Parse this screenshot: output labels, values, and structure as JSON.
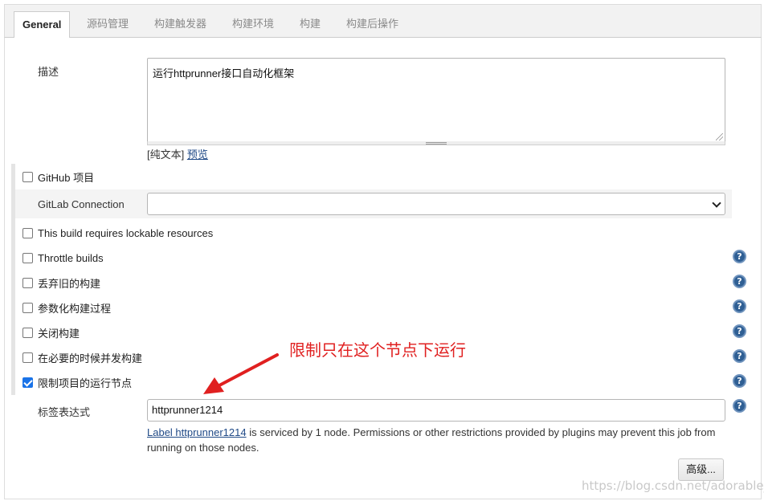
{
  "tabs": [
    {
      "label": "General",
      "active": true
    },
    {
      "label": "源码管理",
      "active": false
    },
    {
      "label": "构建触发器",
      "active": false
    },
    {
      "label": "构建环境",
      "active": false
    },
    {
      "label": "构建",
      "active": false
    },
    {
      "label": "构建后操作",
      "active": false
    }
  ],
  "description": {
    "label": "描述",
    "value": "运行httprunner接口自动化框架",
    "plain_text": "[纯文本]",
    "preview_link": "预览"
  },
  "options": {
    "github_project": {
      "label": "GitHub 项目",
      "checked": false
    },
    "gitlab_connection": {
      "label": "GitLab Connection",
      "value": ""
    },
    "lockable_resources": {
      "label": "This build requires lockable resources",
      "checked": false
    },
    "throttle_builds": {
      "label": "Throttle builds",
      "checked": false
    },
    "discard_old": {
      "label": "丢弃旧的构建",
      "checked": false
    },
    "parameterized": {
      "label": "参数化构建过程",
      "checked": false
    },
    "disable_build": {
      "label": "关闭构建",
      "checked": false
    },
    "concurrent": {
      "label": "在必要的时候并发构建",
      "checked": false
    },
    "restrict_node": {
      "label": "限制项目的运行节点",
      "checked": true
    }
  },
  "label_expression": {
    "label": "标签表达式",
    "value": "httprunner1214",
    "info_link": "Label httprunner1214",
    "info_text": " is serviced by 1 node. Permissions or other restrictions provided by plugins may prevent this job from running on those nodes."
  },
  "advanced_button": "高级...",
  "annotation": "限制只在这个节点下运行",
  "help_glyph": "?",
  "watermark": "https://blog.csdn.net/adorable_",
  "colors": {
    "annotation": "#e02020",
    "checkbox_checked": "#1a73e8",
    "help_icon": "#2f5f94"
  }
}
